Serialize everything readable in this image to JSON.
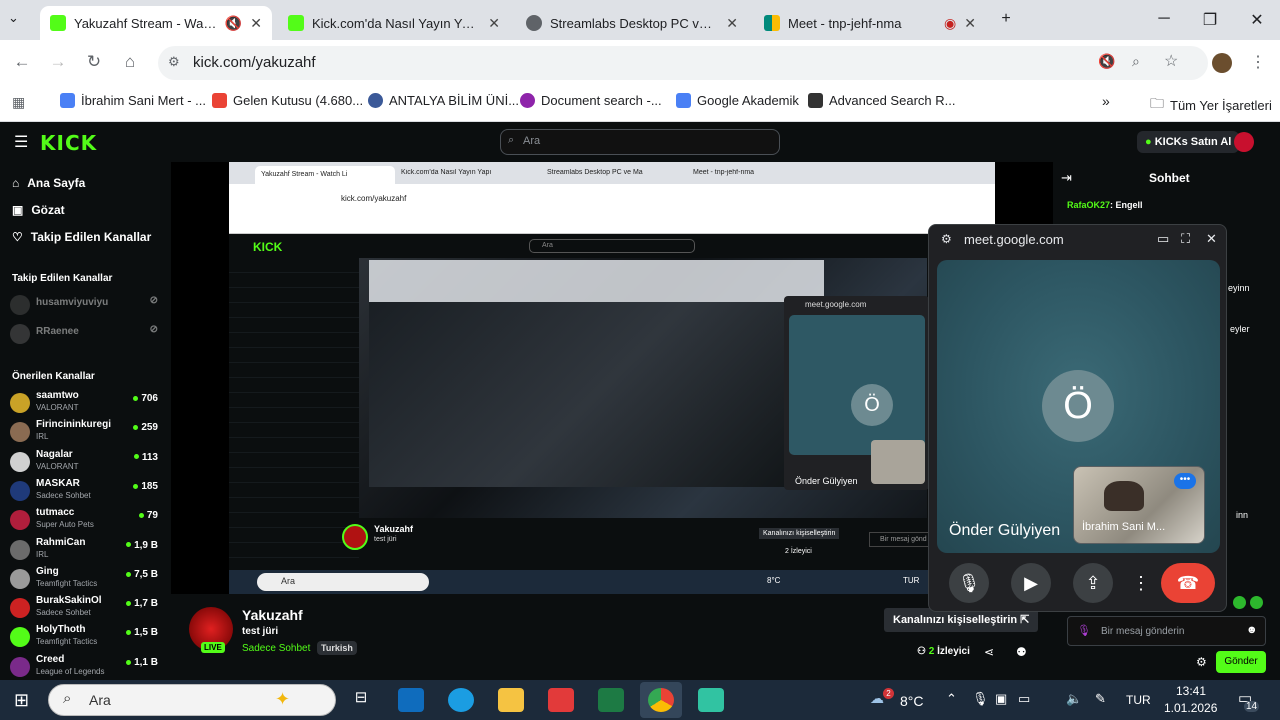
{
  "browser": {
    "tabs": [
      {
        "title": "Yakuzahf Stream - Watch Live on Kick",
        "active": true,
        "favicon_color": "#53fc18"
      },
      {
        "title": "Kick.com'da Nasıl Yayın Yapılır |",
        "active": false,
        "favicon_color": "#53fc18"
      },
      {
        "title": "Streamlabs Desktop PC ve Mac",
        "active": false,
        "favicon_color": "#5f6368"
      },
      {
        "title": "Meet - tnp-jehf-nma",
        "active": false,
        "favicon_color": "#00897b"
      }
    ],
    "url": "kick.com/yakuzahf",
    "bookmarks": [
      {
        "label": "İbrahim Sani Mert - ...",
        "icon_color": "#4a80f5"
      },
      {
        "label": "Gelen Kutusu (4.680...",
        "icon_color": "#ea4335"
      },
      {
        "label": "ANTALYA BİLİM ÜNİ...",
        "icon_color": "#3b5998"
      },
      {
        "label": "Document search -...",
        "icon_color": "#8e24aa"
      },
      {
        "label": "Google Akademik",
        "icon_color": "#4a80f5"
      },
      {
        "label": "Advanced Search R...",
        "icon_color": "#333333"
      }
    ],
    "all_bookmarks": "Tüm Yer İşaretleri"
  },
  "kick": {
    "search_placeholder": "Ara",
    "buy_kicks": "KICKs Satın Al",
    "nav": {
      "home": "Ana Sayfa",
      "browse": "Gözat",
      "following": "Takip Edilen Kanallar"
    },
    "followed_header": "Takip Edilen Kanallar",
    "followed": [
      {
        "name": "husamviyuviyu"
      },
      {
        "name": "RRaenee"
      }
    ],
    "recommended_header": "Önerilen Kanallar",
    "recommended": [
      {
        "name": "saamtwo",
        "category": "VALORANT",
        "viewers": "706",
        "color": "#c9a227"
      },
      {
        "name": "Firincininkuregi",
        "category": "IRL",
        "viewers": "259",
        "color": "#8a6b52"
      },
      {
        "name": "Nagalar",
        "category": "VALORANT",
        "viewers": "113",
        "color": "#d0d0d0"
      },
      {
        "name": "MASKAR",
        "category": "Sadece Sohbet",
        "viewers": "185",
        "color": "#1f3a7a"
      },
      {
        "name": "tutmacc",
        "category": "Super Auto Pets",
        "viewers": "79",
        "color": "#b01e3c"
      },
      {
        "name": "RahmiCan",
        "category": "IRL",
        "viewers": "1,9 B",
        "color": "#6b6b6b"
      },
      {
        "name": "Ging",
        "category": "Teamfight Tactics",
        "viewers": "7,5 B",
        "color": "#9a9a9a"
      },
      {
        "name": "BurakSakinOl",
        "category": "Sadece Sohbet",
        "viewers": "1,7 B",
        "color": "#c22"
      },
      {
        "name": "HolyThoth",
        "category": "Teamfight Tactics",
        "viewers": "1,5 B",
        "color": "#53fc18"
      },
      {
        "name": "Creed",
        "category": "League of Legends",
        "viewers": "1,1 B",
        "color": "#7a2a8a"
      }
    ],
    "streamer": {
      "name": "Yakuzahf",
      "title": "test jüri",
      "category": "Sadece Sohbet",
      "language": "Turkish",
      "live": "LIVE",
      "viewers": "2",
      "viewers_label": "İzleyici"
    },
    "customize_tooltip": "Kanalınızı kişiselleştirin",
    "chat": {
      "title": "Sohbet",
      "messages": [
        {
          "user": "RafaOK27",
          "text": ": Engell"
        }
      ],
      "partial_lines": [
        "eyinn",
        "eyler",
        "inn"
      ],
      "input_placeholder": "Bir mesaj gönderin",
      "send": "Gönder"
    }
  },
  "meet": {
    "url": "meet.google.com",
    "participant_initial": "Ö",
    "participant_name": "Önder Gülyiyen",
    "self_name": "İbrahim Sani M..."
  },
  "taskbar": {
    "search_placeholder": "Ara",
    "weather": "8°C",
    "weather_badge": "2",
    "lang": "TUR",
    "time": "13:41",
    "date": "1.01.2026",
    "notifications": "14"
  },
  "nested": {
    "tab_titles": [
      "Yakuzahf Stream - Watch Li",
      "Kick.com'da Nasıl Yayın Yapı",
      "Streamlabs Desktop PC ve Ma",
      "Meet - tnp-jehf-nma"
    ],
    "url": "kick.com/yakuzahf",
    "meet_url": "meet.google.com",
    "participant": "Önder Gülyiyen",
    "customize": "Kanalınızı kişiselleştirin",
    "viewers": "2 İzleyici",
    "msg": "Bir mesaj gönd",
    "search": "Ara",
    "weather": "8°C",
    "lang": "TUR"
  }
}
